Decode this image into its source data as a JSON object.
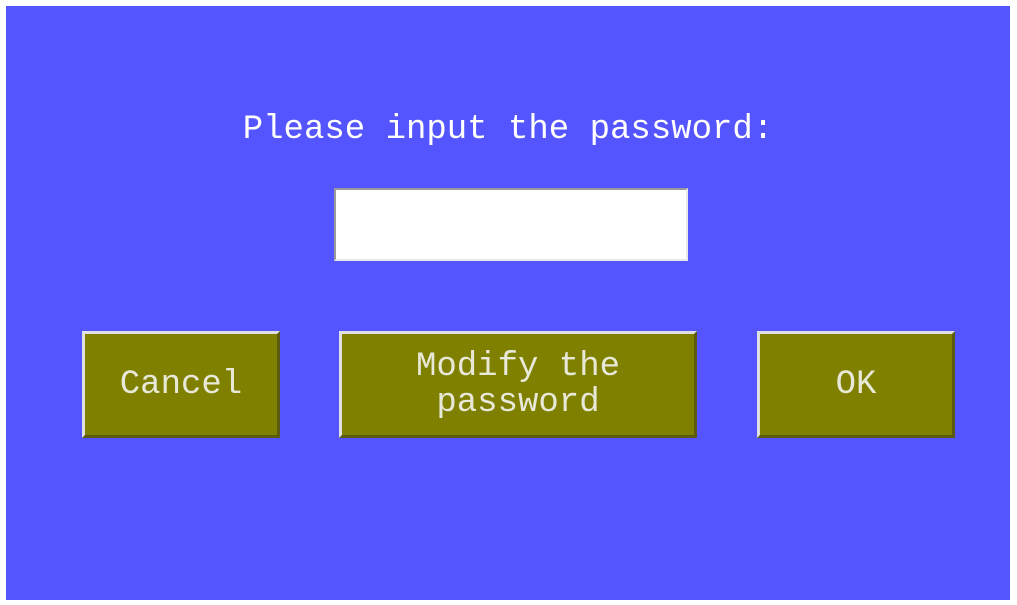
{
  "dialog": {
    "prompt": "Please input the password:",
    "password_value": "",
    "buttons": {
      "cancel": "Cancel",
      "modify": "Modify the\npassword",
      "ok": "OK"
    }
  },
  "colors": {
    "panel_background": "#5555ff",
    "button_background": "#808000",
    "button_text": "#e8e8d8",
    "prompt_text": "#ffffff",
    "input_background": "#ffffff"
  }
}
